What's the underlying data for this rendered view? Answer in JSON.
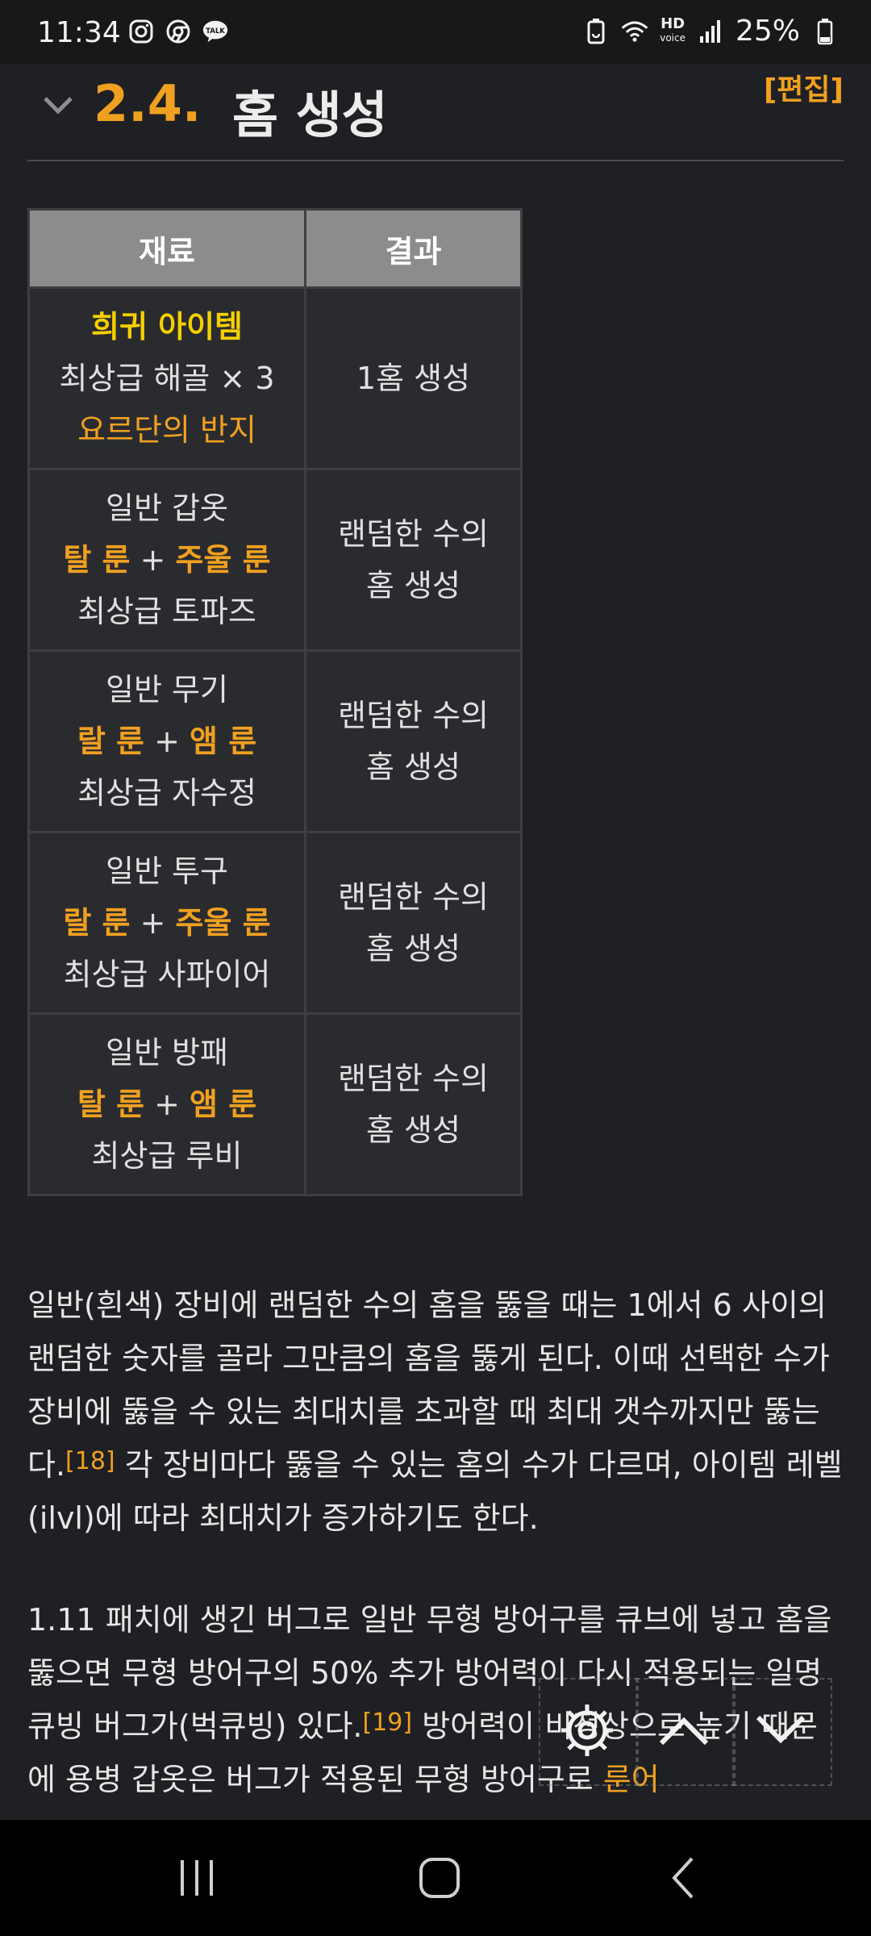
{
  "status_bar": {
    "time": "11:34",
    "left_icons": [
      "instagram-icon",
      "chrome-icon",
      "kakaotalk-icon"
    ],
    "kakao_label": "TALK",
    "hd_label_top": "HD",
    "hd_label_bottom": "voice",
    "battery": "25%"
  },
  "section": {
    "number": "2.4.",
    "title": "홈 생성",
    "edit_label": "[편집]"
  },
  "table": {
    "headers": [
      "재료",
      "결과"
    ],
    "rows": [
      {
        "line1": "희귀 아이템",
        "line2": "최상급 해골 × 3",
        "line3": "요르단의 반지",
        "result": "1홈 생성"
      },
      {
        "line1": "일반 갑옷",
        "rune_a": "탈 룬",
        "plus": "+",
        "rune_b": "주울 룬",
        "line3": "최상급 토파즈",
        "result_1": "랜덤한 수의",
        "result_2": "홈 생성"
      },
      {
        "line1": "일반 무기",
        "rune_a": "랄 룬",
        "plus": "+",
        "rune_b": "앰 룬",
        "line3": "최상급 자수정",
        "result_1": "랜덤한 수의",
        "result_2": "홈 생성"
      },
      {
        "line1": "일반 투구",
        "rune_a": "랄 룬",
        "plus": "+",
        "rune_b": "주울 룬",
        "line3": "최상급 사파이어",
        "result_1": "랜덤한 수의",
        "result_2": "홈 생성"
      },
      {
        "line1": "일반 방패",
        "rune_a": "탈 룬",
        "plus": "+",
        "rune_b": "앰 룬",
        "line3": "최상급 루비",
        "result_1": "랜덤한 수의",
        "result_2": "홈 생성"
      }
    ]
  },
  "paragraph1": {
    "text_a": "일반(흰색) 장비에 랜덤한 수의 홈을 뚫을 때는 1에서 6 사이의 랜덤한 숫자를 골라 그만큼의 홈을 뚫게 된다. 이때 선택한 수가 장비에 뚫을 수 있는 최대치를 초과할 때 최대 갯수까지만 뚫는다.",
    "footnote": "[18]",
    "text_b": " 각 장비마다 뚫을 수 있는 홈의 수가 다르며, 아이템 레벨(ilvl)에 따라 최대치가 증가하기도 한다."
  },
  "paragraph2": {
    "text_a": "1.11 패치에 생긴 버그로 일반 무형 방어구를 큐브에 넣고 홈을 뚫으면 무형 방어구의 50% 추가 방어력이 다시 적용되는 일명 큐빙 버그가(벅큐빙) 있다.",
    "footnote": "[19]",
    "text_b": " 방어력이 비정상으로 높기 때문에 용병 갑옷은 버그가 적용된 무형 방어구로 ",
    "link": "룬어"
  },
  "floating_nav": {
    "buttons": [
      "settings-gear-icon",
      "scroll-up-icon",
      "scroll-down-icon"
    ]
  },
  "system_nav": {
    "buttons": [
      "recent-apps-icon",
      "home-icon",
      "back-icon"
    ]
  },
  "colors": {
    "background": "#1f2023",
    "accent": "#f0a020",
    "rare_yellow": "#f5d000",
    "header_bg": "#8c8c8c"
  }
}
